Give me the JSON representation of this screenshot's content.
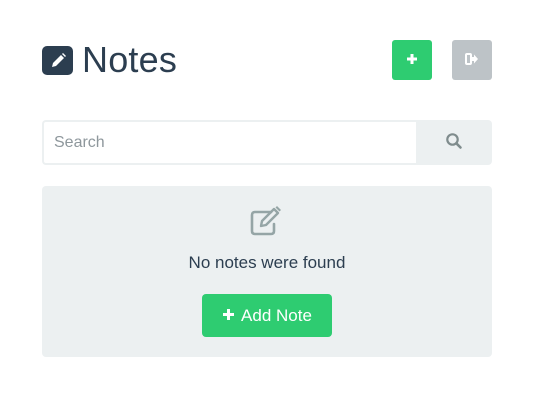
{
  "header": {
    "title": "Notes",
    "title_icon": "pencil-square-icon",
    "add_button_icon": "plus-icon",
    "logout_button_icon": "sign-out-icon"
  },
  "search": {
    "placeholder": "Search",
    "value": "",
    "button_icon": "search-icon"
  },
  "empty_state": {
    "icon": "edit-icon",
    "message": "No notes were found",
    "add_note_label": "Add Note",
    "add_note_icon": "plus-icon"
  },
  "colors": {
    "primary_dark": "#2c3e50",
    "success": "#2ecc71",
    "muted": "#bdc3c7",
    "panel_bg": "#ecf0f1"
  }
}
